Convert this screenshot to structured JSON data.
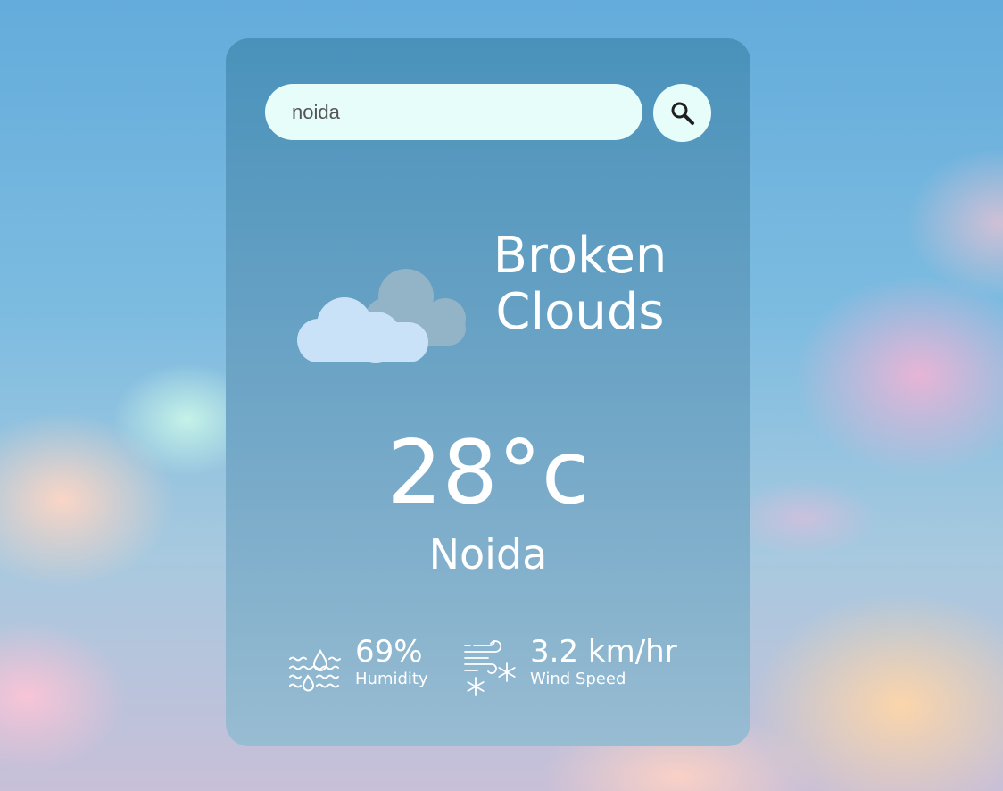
{
  "search": {
    "value": "noida",
    "button_icon": "search-icon"
  },
  "weather": {
    "icon": "broken-clouds-icon",
    "condition_line1": "Broken",
    "condition_line2": "Clouds",
    "temperature": "28°c",
    "city": "Noida"
  },
  "details": {
    "humidity": {
      "icon": "humidity-icon",
      "value": "69%",
      "label": "Humidity"
    },
    "wind": {
      "icon": "wind-icon",
      "value": "3.2 km/hr",
      "label": "Wind Speed"
    }
  },
  "colors": {
    "card_top": "#4a92bb",
    "card_bottom": "#98bcd2",
    "input_background": "#e7fdfa",
    "text": "#ffffff"
  }
}
